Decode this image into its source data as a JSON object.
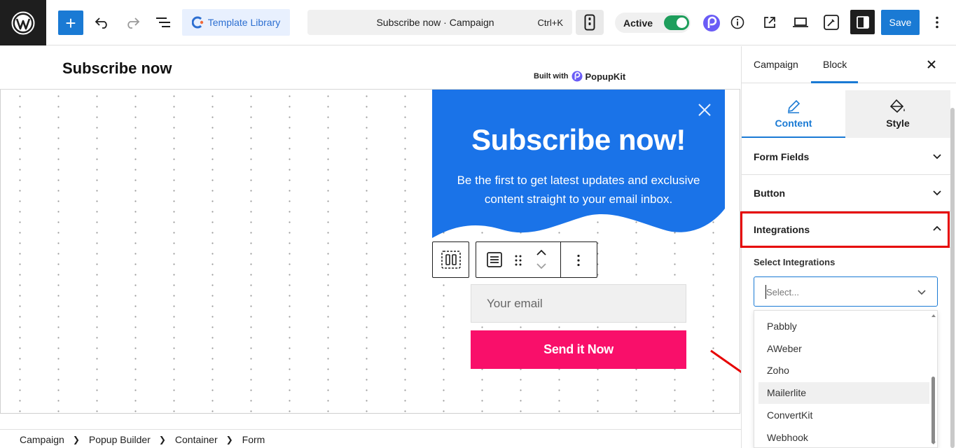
{
  "topbar": {
    "template_library_label": "Template Library",
    "command_title": "Subscribe now · Campaign",
    "command_shortcut": "Ctrl+K",
    "active_label": "Active",
    "save_label": "Save"
  },
  "canvas": {
    "popup_title": "Subscribe now",
    "built_with": "Built with",
    "brand": "PopupKit",
    "headline": "Subscribe now!",
    "description": "Be the first to get latest updates and exclusive content straight to your email inbox.",
    "email_placeholder": "Your email",
    "button_label": "Send it Now"
  },
  "breadcrumbs": [
    "Campaign",
    "Popup Builder",
    "Container",
    "Form"
  ],
  "sidebar": {
    "tabs": [
      "Campaign",
      "Block"
    ],
    "subtabs": [
      "Content",
      "Style"
    ],
    "panels": [
      "Form Fields",
      "Button",
      "Integrations"
    ],
    "select_label": "Select Integrations",
    "select_placeholder": "Select...",
    "options": [
      "Pabbly",
      "AWeber",
      "Zoho",
      "Mailerlite",
      "ConvertKit",
      "Webhook"
    ],
    "highlighted_option": "Mailerlite"
  },
  "colors": {
    "accent": "#1a7ad4",
    "popup_blue": "#1a73e8",
    "button_pink": "#f90f6a",
    "highlight_red": "#e60000"
  }
}
